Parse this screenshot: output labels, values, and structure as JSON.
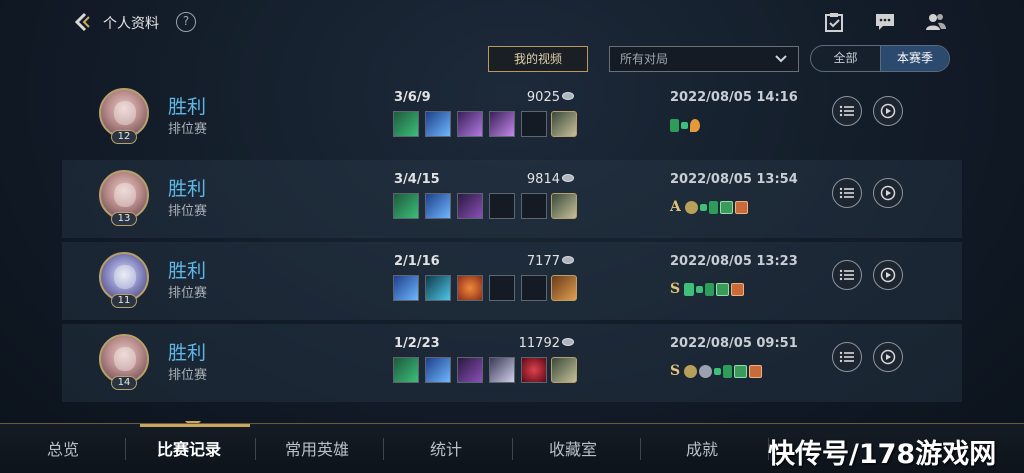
{
  "header": {
    "title": "个人资料",
    "help_label": "?",
    "icons": [
      "back-chevron-icon",
      "help-icon",
      "calendar-check-icon",
      "chat-bubble-icon",
      "friends-icon"
    ]
  },
  "controls": {
    "videos_button": "我的视频",
    "filter_value": "所有对局",
    "segment": {
      "all": "全部",
      "season": "本赛季",
      "active": "本赛季"
    }
  },
  "matches": [
    {
      "result": "胜利",
      "mode": "排位赛",
      "level": "12",
      "kda": "3/6/9",
      "gold": "9025",
      "datetime": "2022/08/05 14:16",
      "badge_letter": ""
    },
    {
      "result": "胜利",
      "mode": "排位赛",
      "level": "13",
      "kda": "3/4/15",
      "gold": "9814",
      "datetime": "2022/08/05 13:54",
      "badge_letter": "A"
    },
    {
      "result": "胜利",
      "mode": "排位赛",
      "level": "11",
      "kda": "2/1/16",
      "gold": "7177",
      "datetime": "2022/08/05 13:23",
      "badge_letter": "S"
    },
    {
      "result": "胜利",
      "mode": "排位赛",
      "level": "14",
      "kda": "1/2/23",
      "gold": "11792",
      "datetime": "2022/08/05 09:51",
      "badge_letter": "S"
    }
  ],
  "nav": {
    "items": [
      "总览",
      "比赛记录",
      "常用英雄",
      "统计",
      "收藏室",
      "成就"
    ],
    "active": "比赛记录"
  },
  "watermark": "快传号/178游戏网",
  "colors": {
    "win_text": "#5fb7e6",
    "gold_accent": "#c8a860",
    "active_segment": "#2c4a6e"
  }
}
